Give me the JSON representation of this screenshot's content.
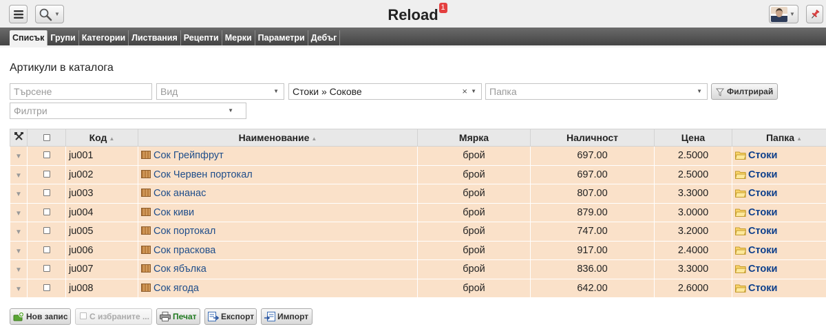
{
  "app": {
    "title": "Reload",
    "notifications": "1"
  },
  "tabs": [
    {
      "label": "Списък",
      "active": true
    },
    {
      "label": "Групи"
    },
    {
      "label": "Категории"
    },
    {
      "label": "Листвания"
    },
    {
      "label": "Рецепти"
    },
    {
      "label": "Мерки"
    },
    {
      "label": "Параметри"
    },
    {
      "label": "Дебъг"
    }
  ],
  "page": {
    "title": "Артикули в каталога"
  },
  "filters": {
    "search_placeholder": "Търсене",
    "type_placeholder": "Вид",
    "group_value": "Стоки » Сокове",
    "folder_placeholder": "Папка",
    "filter_button": "Филтрирай",
    "filters_placeholder": "Филтри"
  },
  "table": {
    "headers": {
      "code": "Код",
      "name": "Наименование",
      "measure": "Мярка",
      "quantity": "Наличност",
      "price": "Цена",
      "folder": "Папка"
    },
    "rows": [
      {
        "code": "ju001",
        "name": "Сок Грейпфрут",
        "measure": "брой",
        "quantity": "697.00",
        "price": "2.5000",
        "folder": "Стоки"
      },
      {
        "code": "ju002",
        "name": "Сок Червен портокал",
        "measure": "брой",
        "quantity": "697.00",
        "price": "2.5000",
        "folder": "Стоки"
      },
      {
        "code": "ju003",
        "name": "Сок ананас",
        "measure": "брой",
        "quantity": "807.00",
        "price": "3.3000",
        "folder": "Стоки"
      },
      {
        "code": "ju004",
        "name": "Сок киви",
        "measure": "брой",
        "quantity": "879.00",
        "price": "3.0000",
        "folder": "Стоки"
      },
      {
        "code": "ju005",
        "name": "Сок портокал",
        "measure": "брой",
        "quantity": "747.00",
        "price": "3.2000",
        "folder": "Стоки"
      },
      {
        "code": "ju006",
        "name": "Сок праскова",
        "measure": "брой",
        "quantity": "917.00",
        "price": "2.4000",
        "folder": "Стоки"
      },
      {
        "code": "ju007",
        "name": "Сок ябълка",
        "measure": "брой",
        "quantity": "836.00",
        "price": "3.3000",
        "folder": "Стоки"
      },
      {
        "code": "ju008",
        "name": "Сок ягода",
        "measure": "брой",
        "quantity": "642.00",
        "price": "2.6000",
        "folder": "Стоки"
      }
    ]
  },
  "toolbar": {
    "new_record": "Нов запис",
    "with_selected": "С избраните ...",
    "print": "Печат",
    "export": "Експорт",
    "import": "Импорт"
  },
  "colors": {
    "row_background": "#fae1c9",
    "header_background": "#e8e8e8",
    "link": "#1e4d8a",
    "badge": "#e43f3f"
  },
  "icons": {
    "menu": "menu-icon",
    "search": "search-icon",
    "pin": "pin-icon",
    "tools": "tools-icon",
    "item": "box-icon",
    "folder": "folder-icon",
    "filter": "funnel-icon",
    "new": "add-icon",
    "print": "printer-icon",
    "export": "export-icon",
    "import": "import-icon"
  }
}
